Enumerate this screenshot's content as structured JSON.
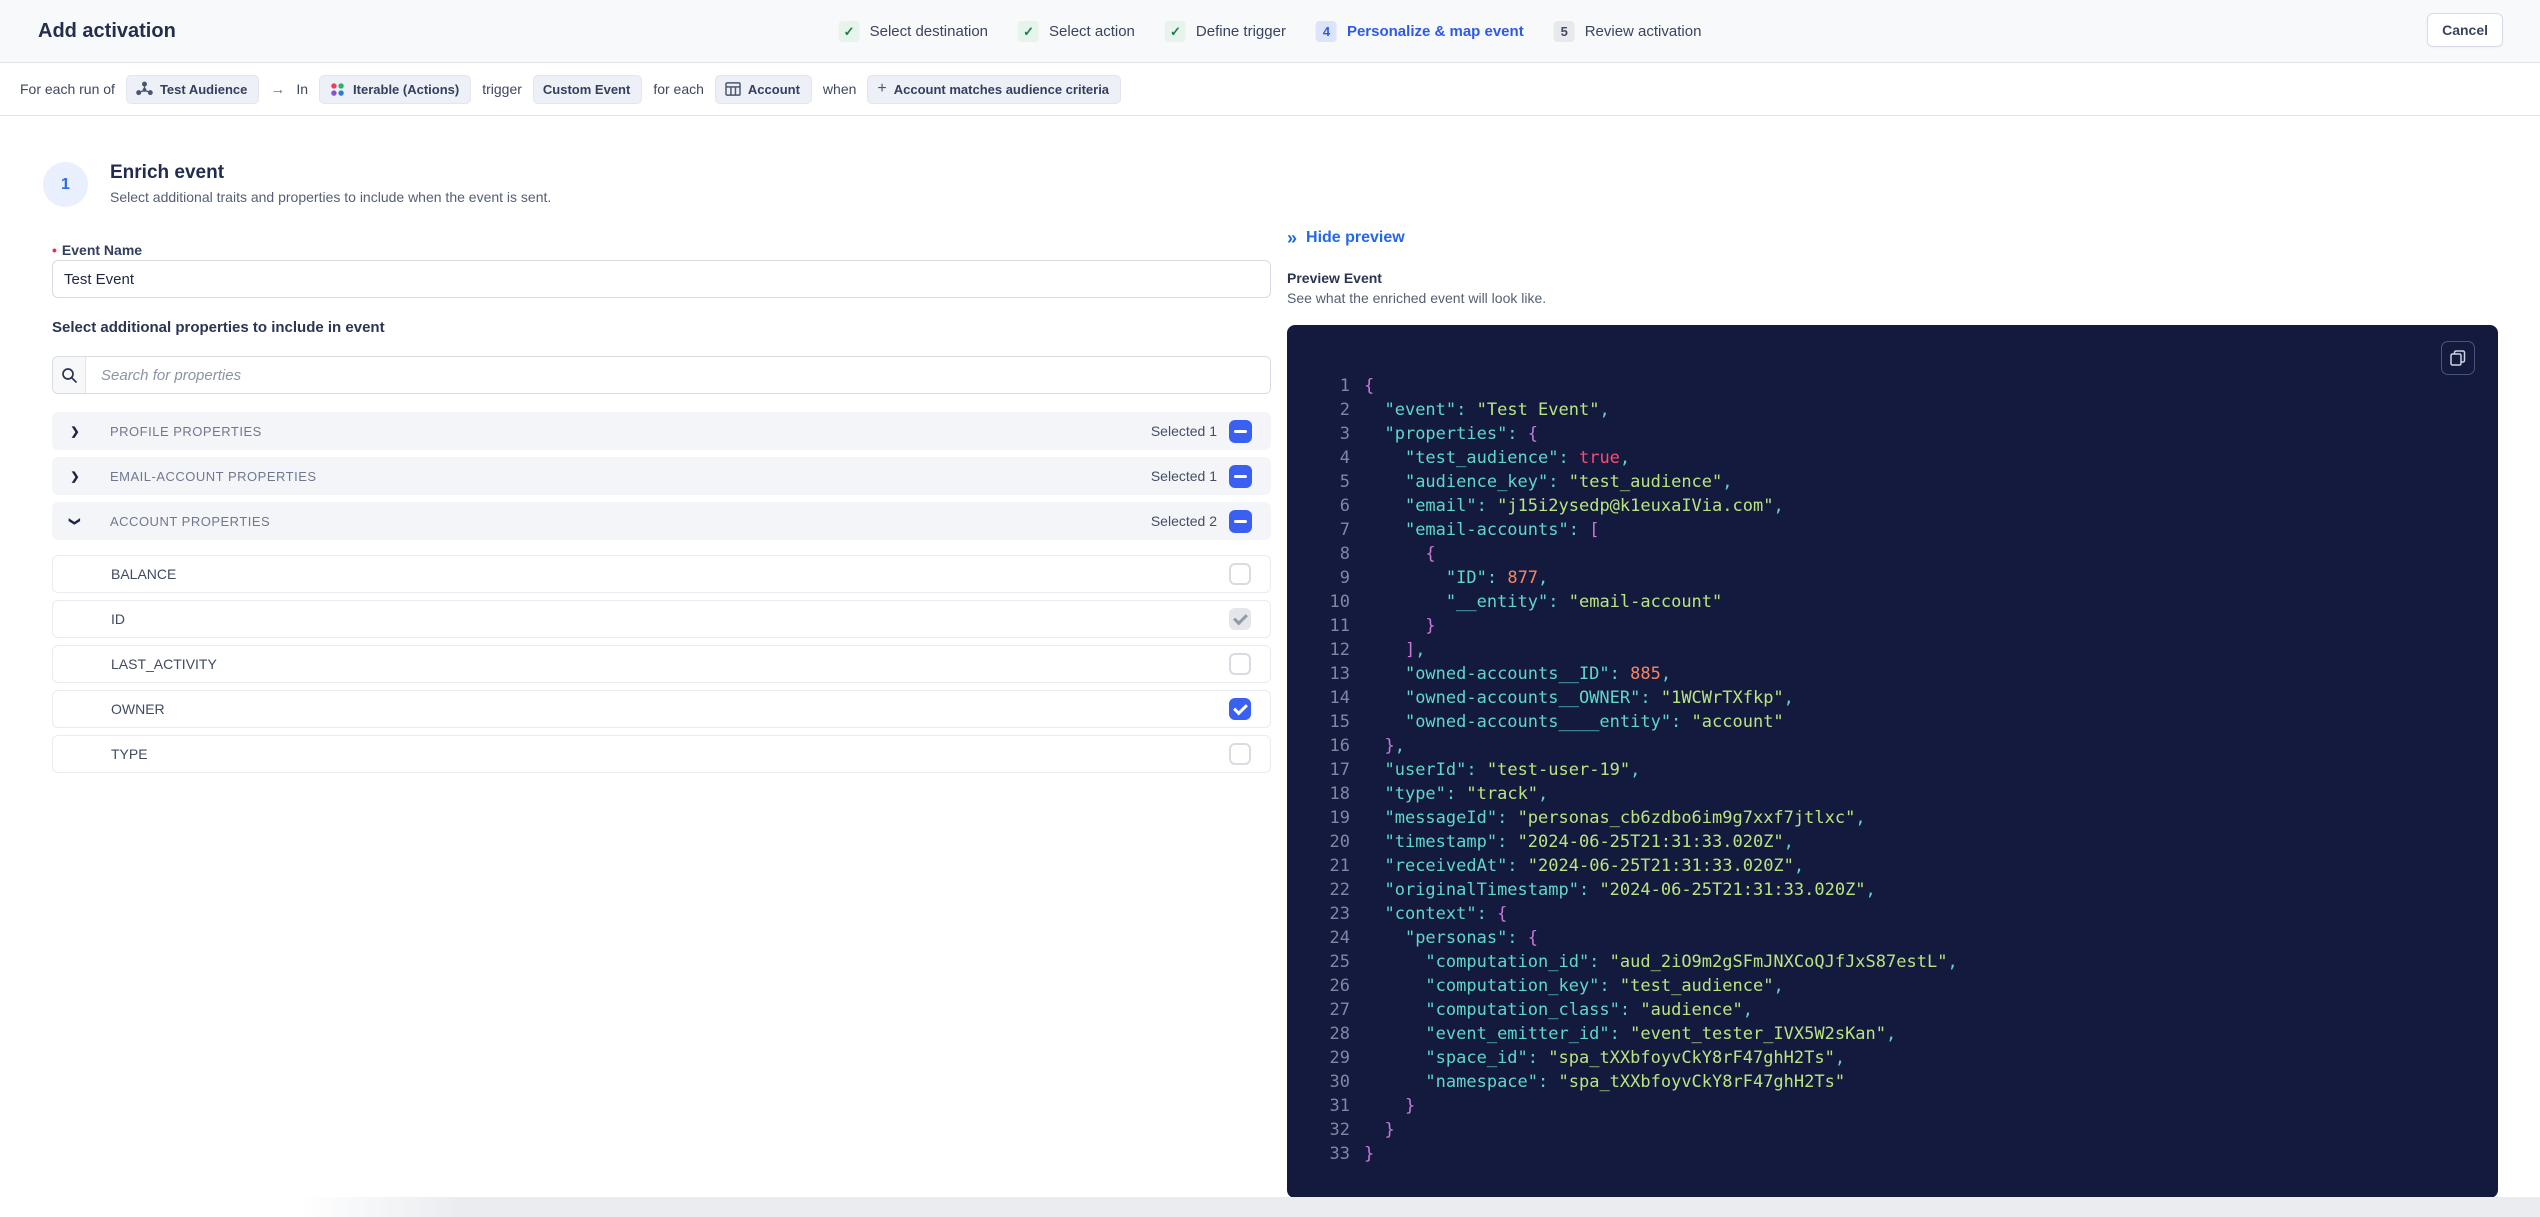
{
  "header": {
    "title": "Add activation",
    "cancel_label": "Cancel",
    "steps": [
      {
        "label": "Select destination",
        "state": "done"
      },
      {
        "label": "Select action",
        "state": "done"
      },
      {
        "label": "Define trigger",
        "state": "done"
      },
      {
        "label": "Personalize & map event",
        "state": "active",
        "num": "4"
      },
      {
        "label": "Review activation",
        "state": "upcoming",
        "num": "5"
      }
    ]
  },
  "breadcrumb": [
    {
      "type": "text",
      "text": "For each run of"
    },
    {
      "type": "chip",
      "icon": "audience-icon",
      "text": "Test Audience"
    },
    {
      "type": "arrow",
      "text": "→"
    },
    {
      "type": "text",
      "text": "In"
    },
    {
      "type": "chip",
      "icon": "iterable-icon",
      "text": "Iterable (Actions)"
    },
    {
      "type": "text",
      "text": "trigger"
    },
    {
      "type": "chip",
      "icon": "",
      "text": "Custom Event"
    },
    {
      "type": "text",
      "text": "for each"
    },
    {
      "type": "chip",
      "icon": "table-icon",
      "text": "Account"
    },
    {
      "type": "text",
      "text": "when"
    },
    {
      "type": "chip",
      "icon": "plus-icon",
      "text": "Account matches audience criteria"
    }
  ],
  "step_section": {
    "number": "1",
    "title": "Enrich event",
    "subtitle": "Select additional traits and properties to include when the event is sent."
  },
  "form": {
    "event_name_label": "Event Name",
    "event_name_value": "Test Event",
    "properties_label": "Select additional properties to include in event",
    "search_placeholder": "Search for properties"
  },
  "sections": [
    {
      "label": "PROFILE PROPERTIES",
      "selected": "Selected 1",
      "expanded": false,
      "properties": []
    },
    {
      "label": "EMAIL-ACCOUNT PROPERTIES",
      "selected": "Selected 1",
      "expanded": false,
      "properties": []
    },
    {
      "label": "ACCOUNT PROPERTIES",
      "selected": "Selected 2",
      "expanded": true,
      "properties": [
        {
          "label": "BALANCE",
          "state": "unchecked"
        },
        {
          "label": "ID",
          "state": "checked-disabled"
        },
        {
          "label": "LAST_ACTIVITY",
          "state": "unchecked"
        },
        {
          "label": "OWNER",
          "state": "checked"
        },
        {
          "label": "TYPE",
          "state": "unchecked"
        }
      ]
    }
  ],
  "preview": {
    "hide_label": "Hide preview",
    "title": "Preview Event",
    "subtitle": "See what the enriched event will look like.",
    "code_lines": [
      "{",
      "  \"event\": \"Test Event\",",
      "  \"properties\": {",
      "    \"test_audience\": true,",
      "    \"audience_key\": \"test_audience\",",
      "    \"email\": \"j15i2ysedp@k1euxaIVia.com\",",
      "    \"email-accounts\": [",
      "      {",
      "        \"ID\": 877,",
      "        \"__entity\": \"email-account\"",
      "      }",
      "    ],",
      "    \"owned-accounts__ID\": 885,",
      "    \"owned-accounts__OWNER\": \"1WCWrTXfkp\",",
      "    \"owned-accounts____entity\": \"account\"",
      "  },",
      "  \"userId\": \"test-user-19\",",
      "  \"type\": \"track\",",
      "  \"messageId\": \"personas_cb6zdbo6im9g7xxf7jtlxc\",",
      "  \"timestamp\": \"2024-06-25T21:31:33.020Z\",",
      "  \"receivedAt\": \"2024-06-25T21:31:33.020Z\",",
      "  \"originalTimestamp\": \"2024-06-25T21:31:33.020Z\",",
      "  \"context\": {",
      "    \"personas\": {",
      "      \"computation_id\": \"aud_2iO9m2gSFmJNXCoQJfJxS87estL\",",
      "      \"computation_key\": \"test_audience\",",
      "      \"computation_class\": \"audience\",",
      "      \"event_emitter_id\": \"event_tester_IVX5W2sKan\",",
      "      \"space_id\": \"spa_tXXbfoyvCkY8rF47ghH2Ts\",",
      "      \"namespace\": \"spa_tXXbfoyvCkY8rF47ghH2Ts\"",
      "    }",
      "  }",
      "}"
    ]
  },
  "colors": {
    "accent_blue": "#2d5be8",
    "check_green": "#1b7f4d",
    "checkbox_blue": "#3a60f2",
    "code_bg": "#141a3e"
  }
}
